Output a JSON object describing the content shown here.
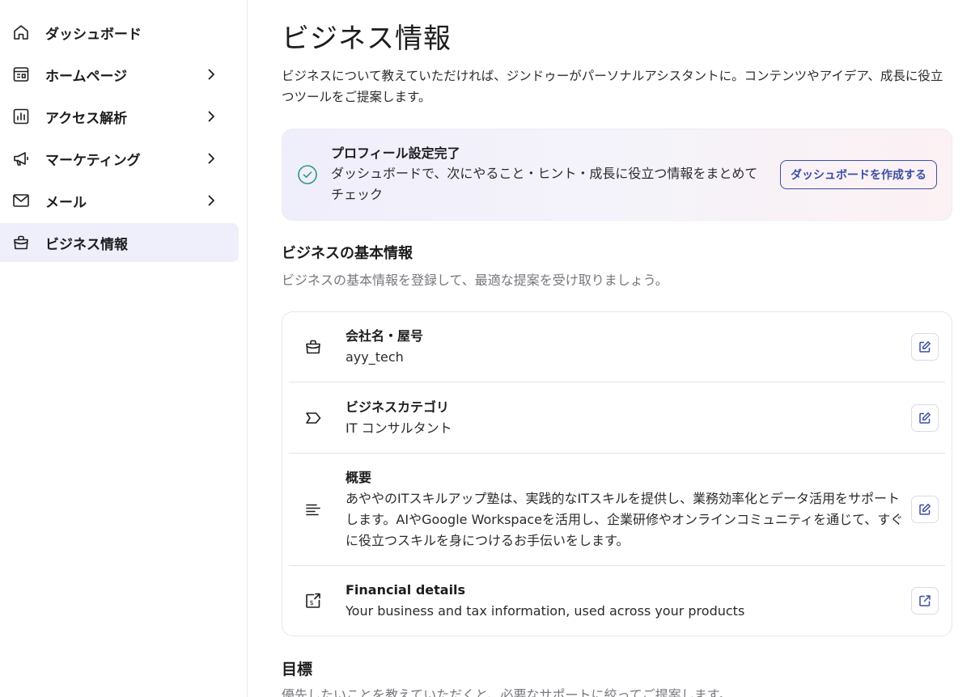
{
  "sidebar": {
    "items": [
      {
        "label": "ダッシュボード",
        "icon": "home-icon",
        "has_chevron": false,
        "active": false
      },
      {
        "label": "ホームページ",
        "icon": "website-icon",
        "has_chevron": true,
        "active": false
      },
      {
        "label": "アクセス解析",
        "icon": "analytics-icon",
        "has_chevron": true,
        "active": false
      },
      {
        "label": "マーケティング",
        "icon": "megaphone-icon",
        "has_chevron": true,
        "active": false
      },
      {
        "label": "メール",
        "icon": "mail-icon",
        "has_chevron": true,
        "active": false
      },
      {
        "label": "ビジネス情報",
        "icon": "briefcase-icon",
        "has_chevron": false,
        "active": true
      }
    ]
  },
  "main": {
    "title": "ビジネス情報",
    "description": "ビジネスについて教えていただければ、ジンドゥーがパーソナルアシスタントに。コンテンツやアイデア、成長に役立つツールをご提案します。",
    "banner": {
      "title": "プロフィール設定完了",
      "body": "ダッシュボードで、次にやること・ヒント・成長に役立つ情報をまとめてチェック",
      "button_label": "ダッシュボードを作成する"
    },
    "basic_info": {
      "title": "ビジネスの基本情報",
      "subtitle": "ビジネスの基本情報を登録して、最適な提案を受け取りましょう。",
      "rows": [
        {
          "label": "会社名・屋号",
          "value": "ayy_tech",
          "icon": "briefcase-icon",
          "action": "edit-icon"
        },
        {
          "label": "ビジネスカテゴリ",
          "value": "IT コンサルタント",
          "icon": "tag-icon",
          "action": "edit-icon"
        },
        {
          "label": "概要",
          "value": "あややのITスキルアップ塾は、実践的なITスキルを提供し、業務効率化とデータ活用をサポートします。AIやGoogle Workspaceを活用し、企業研修やオンラインコミュニティを通じて、すぐに役立つスキルを身につけるお手伝いをします。",
          "icon": "text-lines-icon",
          "action": "edit-icon"
        },
        {
          "label": "Financial details",
          "value": "Your business and tax information, used across your products",
          "icon": "financial-icon",
          "action": "external-link-icon"
        }
      ]
    },
    "goals": {
      "title": "目標",
      "subtitle": "優先したいことを教えていただくと、必要なサポートに絞ってご提案します。"
    }
  },
  "colors": {
    "accent": "#3c4fa3",
    "active_nav_bg": "#efeffb",
    "check_green": "#2e9b7a",
    "muted_text": "#77777d"
  }
}
